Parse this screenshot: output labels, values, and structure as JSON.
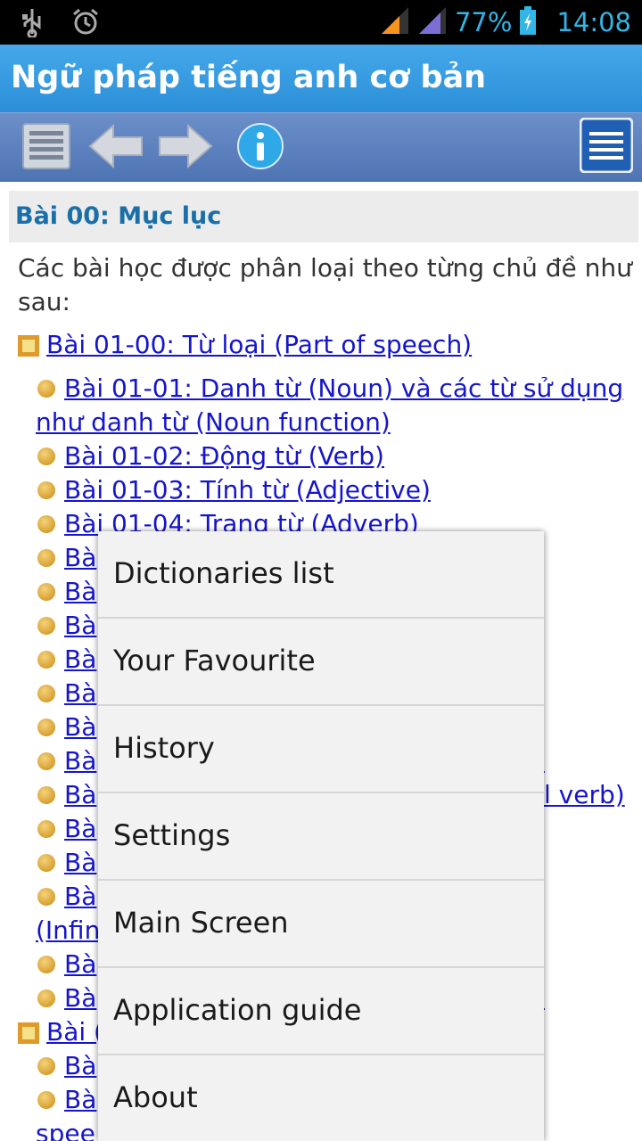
{
  "status_bar": {
    "battery_percent": "77%",
    "time": "14:08",
    "icons": [
      "usb-icon",
      "alarm-icon",
      "signal-icon",
      "battery-icon"
    ]
  },
  "app": {
    "title": "Ngữ pháp tiếng anh cơ bản"
  },
  "toolbar": {
    "icons": [
      "list-icon",
      "back-arrow-icon",
      "forward-arrow-icon",
      "info-icon",
      "menu-icon"
    ]
  },
  "content": {
    "lesson_title": "Bài 00: Mục lục",
    "intro": "Các bài học được phân loại theo từng chủ đề như sau:",
    "section1": "Bài 01-00: Từ loại (Part of speech)",
    "items": [
      "Bài 01-01: Danh từ (Noun) và các từ sử dụng như danh từ (Noun function)",
      "Bài 01-02: Động từ (Verb)",
      "Bài 01-03: Tính từ (Adjective)",
      "Bài 01-04: Trạng từ (Adverb)"
    ],
    "partial": {
      "bai": "Bà",
      "bai_short": "Bài (",
      "infin": "(Infin",
      "spee": "spee",
      "tail_1": ")",
      "tail_2": "l verb)",
      "tail_3": ")"
    }
  },
  "menu": {
    "items": [
      "Dictionaries list",
      "Your Favourite",
      "History",
      "Settings",
      "Main Screen",
      "Application guide",
      "About"
    ]
  },
  "colors": {
    "title_bar": "#3a9fe3",
    "toolbar": "#5e82c0",
    "link": "#1515cc",
    "lesson_title": "#1a6fa8",
    "status_accent": "#33b5e5"
  }
}
